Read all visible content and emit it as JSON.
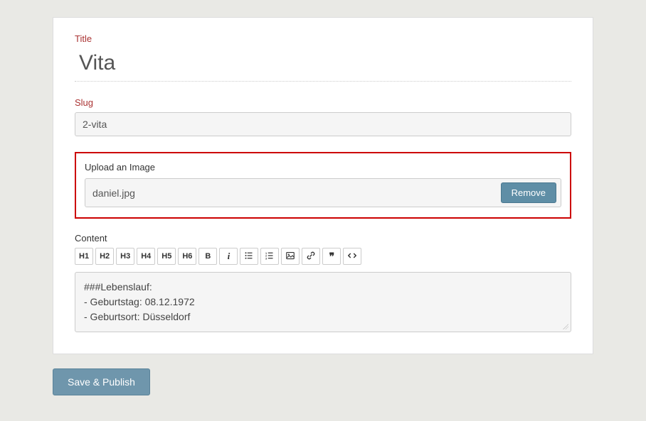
{
  "form": {
    "title_label": "Title",
    "title_value": "Vita",
    "slug_label": "Slug",
    "slug_value": "2-vita",
    "upload_label": "Upload an Image",
    "upload_filename": "daniel.jpg",
    "remove_label": "Remove",
    "content_label": "Content",
    "content_value": "###Lebenslauf:\n- Geburtstag: 08.12.1972\n- Geburtsort: Düsseldorf",
    "save_label": "Save & Publish"
  },
  "toolbar": {
    "h1": "H1",
    "h2": "H2",
    "h3": "H3",
    "h4": "H4",
    "h5": "H5",
    "h6": "H6",
    "bold": "B",
    "italic": "i",
    "quote": "❞"
  }
}
